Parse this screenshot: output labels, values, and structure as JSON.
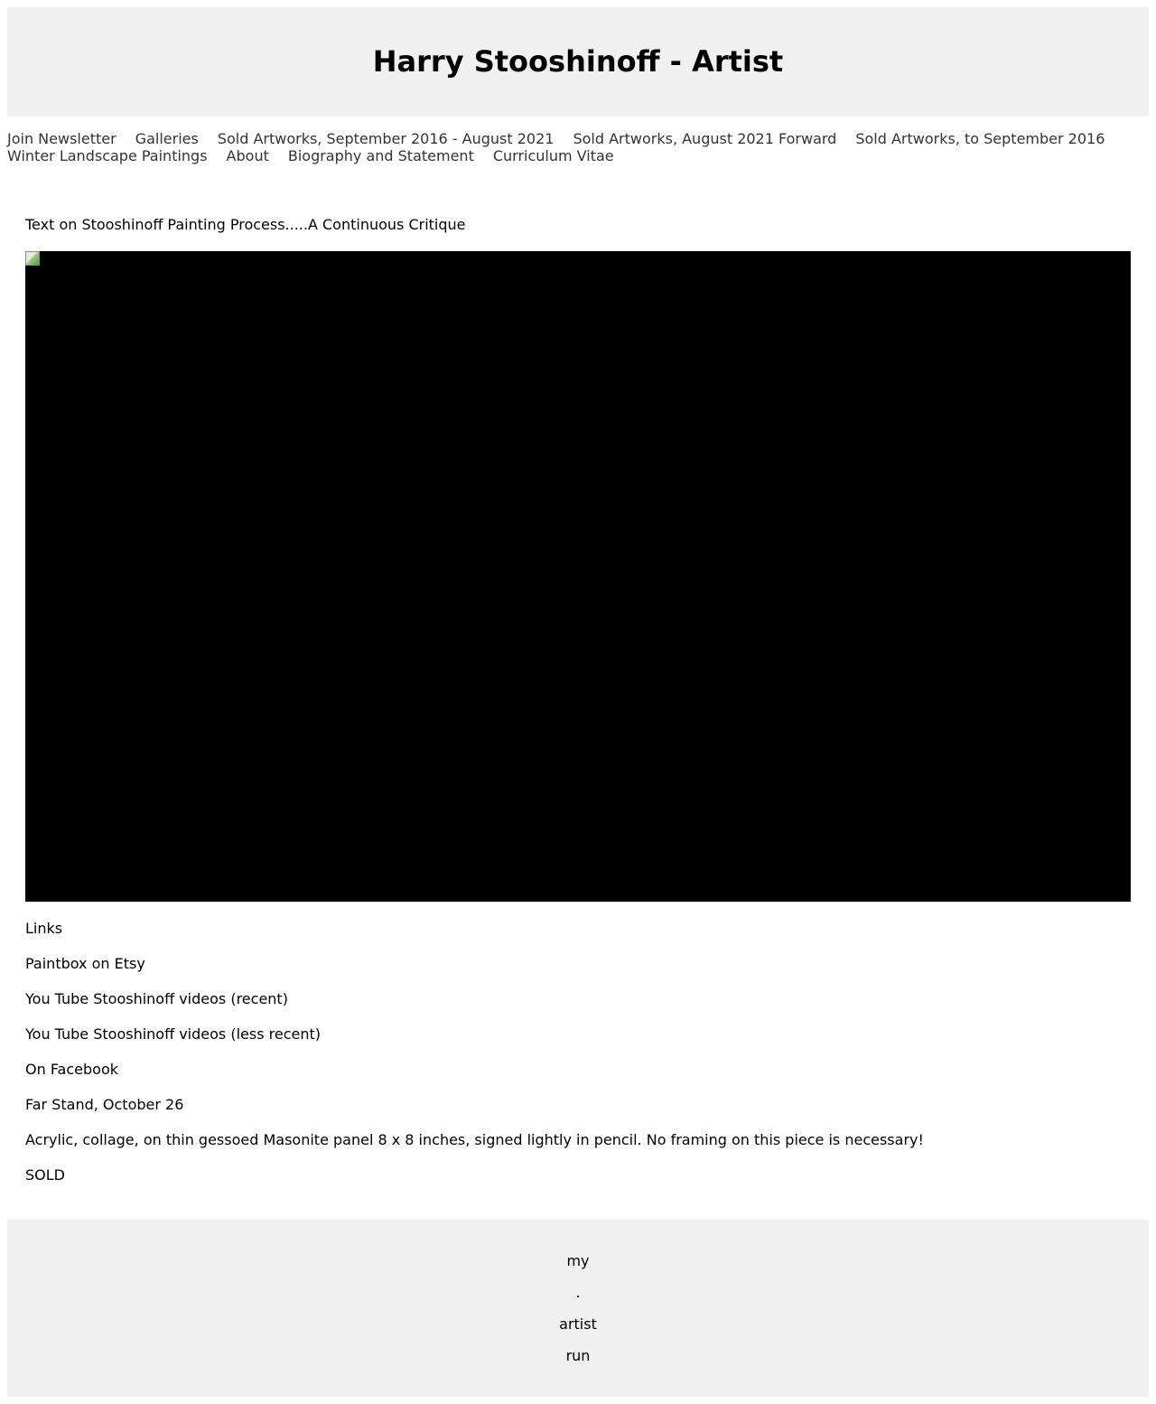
{
  "header": {
    "title": "Harry Stooshinoff - Artist"
  },
  "nav": {
    "row1": [
      "Join Newsletter",
      "Galleries",
      "Sold Artworks, September 2016 - August 2021",
      "Sold Artworks, August 2021 Forward",
      "Sold Artworks, to September 2016"
    ],
    "row2": [
      "Winter Landscape Paintings",
      "About",
      "Biography and Statement",
      "Curriculum Vitae"
    ]
  },
  "main": {
    "intro_link": "Text on Stooshinoff Painting Process.....A Continuous Critique",
    "links_heading": "Links",
    "links": [
      "Paintbox on Etsy",
      "You Tube Stooshinoff videos (recent)",
      "You Tube Stooshinoff videos (less recent)",
      "On Facebook"
    ],
    "artwork": {
      "title": "Far Stand, October 26",
      "description": "Acrylic, collage, on thin gessoed Masonite panel 8 x 8 inches, signed lightly in pencil. No framing on this piece is necessary!",
      "status": "SOLD"
    }
  },
  "footer": {
    "lines": [
      "my",
      ".",
      "artist",
      "run"
    ]
  },
  "colors": {
    "header_bg": "#f0f0f0",
    "footer_bg": "#f0f0f0",
    "nav_text": "#333333",
    "image_bg": "#000000"
  },
  "icons": {
    "image_placeholder": "broken-image-icon"
  }
}
